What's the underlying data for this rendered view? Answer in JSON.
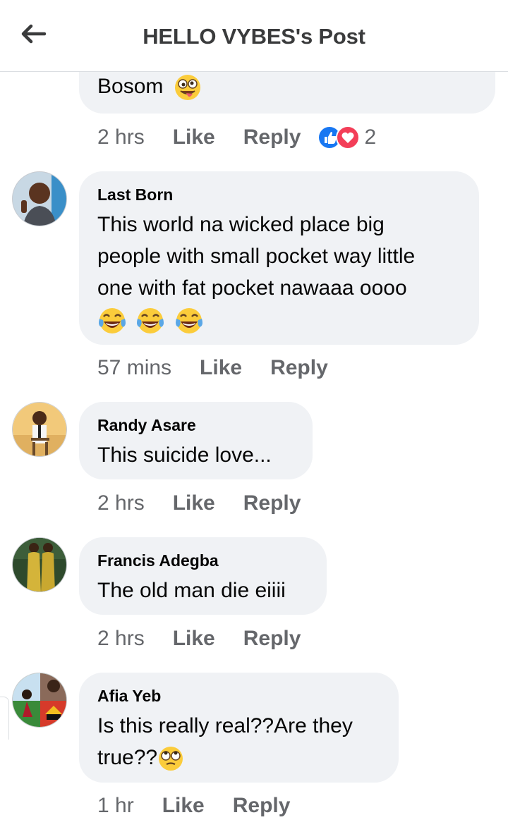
{
  "header": {
    "title": "HELLO VYBES's Post",
    "back_icon": "arrow-left-icon"
  },
  "colors": {
    "bubble": "#f0f2f5",
    "meta_text": "#65676b",
    "like_blue": "#1877f2",
    "love_red": "#f33e58",
    "emoji_yellow": "#fbcc3b"
  },
  "comments": [
    {
      "text": "Bosom",
      "emoji": "zany-face-icon",
      "time": "2 hrs",
      "like": "Like",
      "reply": "Reply",
      "reactions": {
        "icons": [
          "like-reaction-icon",
          "love-reaction-icon"
        ],
        "count": "2"
      }
    },
    {
      "author": "Last Born",
      "lines": [
        "This world na wicked place big",
        "people with small pocket way little",
        "one with fat pocket nawaaa oooo"
      ],
      "emoji": "laughing-tears-icon",
      "time": "57 mins",
      "like": "Like",
      "reply": "Reply"
    },
    {
      "author": "Randy Asare",
      "text": "This suicide love...",
      "time": "2 hrs",
      "like": "Like",
      "reply": "Reply"
    },
    {
      "author": "Francis Adegba",
      "text": "The old man die eiiii",
      "time": "2 hrs",
      "like": "Like",
      "reply": "Reply"
    },
    {
      "author": "Afia Yeb",
      "lines": [
        "Is this really real??Are they",
        "true??"
      ],
      "emoji": "eye-roll-face-icon",
      "time": "1 hr",
      "like": "Like",
      "reply": "Reply"
    }
  ]
}
